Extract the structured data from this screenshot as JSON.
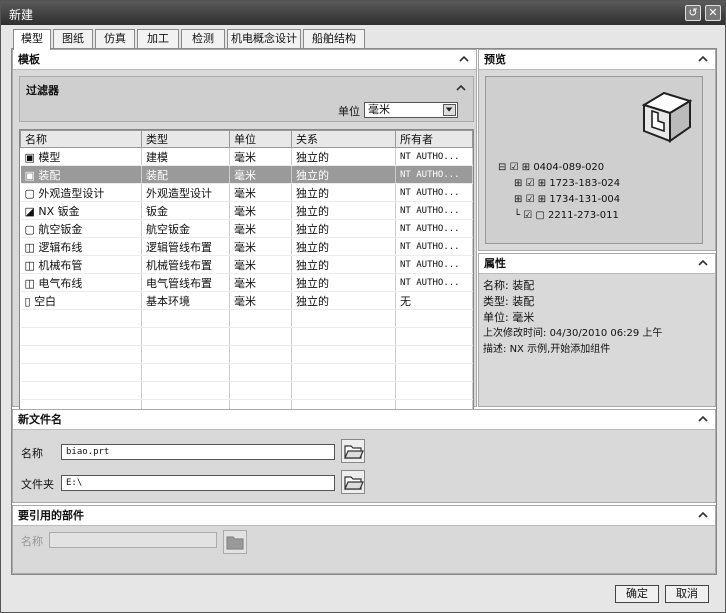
{
  "window": {
    "title": "新建"
  },
  "tabs": [
    {
      "label": "模型"
    },
    {
      "label": "图纸"
    },
    {
      "label": "仿真"
    },
    {
      "label": "加工"
    },
    {
      "label": "检测"
    },
    {
      "label": "机电概念设计"
    },
    {
      "label": "船舶结构"
    }
  ],
  "templates": {
    "title": "模板",
    "filter": {
      "title": "过滤器",
      "unit_label": "单位",
      "unit_value": "毫米"
    },
    "columns": [
      "名称",
      "类型",
      "单位",
      "关系",
      "所有者"
    ],
    "rows": [
      {
        "name": "模型",
        "type": "建模",
        "unit": "毫米",
        "relation": "独立的",
        "owner": "NT AUTHO..."
      },
      {
        "name": "装配",
        "type": "装配",
        "unit": "毫米",
        "relation": "独立的",
        "owner": "NT AUTHO..."
      },
      {
        "name": "外观造型设计",
        "type": "外观造型设计",
        "unit": "毫米",
        "relation": "独立的",
        "owner": "NT AUTHO..."
      },
      {
        "name": "NX 钣金",
        "type": "钣金",
        "unit": "毫米",
        "relation": "独立的",
        "owner": "NT AUTHO..."
      },
      {
        "name": "航空钣金",
        "type": "航空钣金",
        "unit": "毫米",
        "relation": "独立的",
        "owner": "NT AUTHO..."
      },
      {
        "name": "逻辑布线",
        "type": "逻辑管线布置",
        "unit": "毫米",
        "relation": "独立的",
        "owner": "NT AUTHO..."
      },
      {
        "name": "机械布管",
        "type": "机械管线布置",
        "unit": "毫米",
        "relation": "独立的",
        "owner": "NT AUTHO..."
      },
      {
        "name": "电气布线",
        "type": "电气管线布置",
        "unit": "毫米",
        "relation": "独立的",
        "owner": "NT AUTHO..."
      },
      {
        "name": "空白",
        "type": "基本环境",
        "unit": "毫米",
        "relation": "独立的",
        "owner": "无"
      }
    ]
  },
  "preview": {
    "title": "预览",
    "tree": [
      "0404-089-020",
      "1723-183-024",
      "1734-131-004",
      "2211-273-011"
    ]
  },
  "properties": {
    "title": "属性",
    "name_label": "名称:",
    "name_value": "装配",
    "type_label": "类型:",
    "type_value": "装配",
    "unit_label": "单位:",
    "unit_value": "毫米",
    "modified_label": "上次修改时间:",
    "modified_value": "04/30/2010 06:29 上午",
    "desc_label": "描述:",
    "desc_value": "NX 示例,开始添加组件"
  },
  "new_file": {
    "title": "新文件名",
    "name_label": "名称",
    "name_value": "biao.prt",
    "folder_label": "文件夹",
    "folder_value": "E:\\"
  },
  "referenced": {
    "title": "要引用的部件",
    "name_label": "名称",
    "name_value": ""
  },
  "buttons": {
    "ok": "确定",
    "cancel": "取消"
  }
}
